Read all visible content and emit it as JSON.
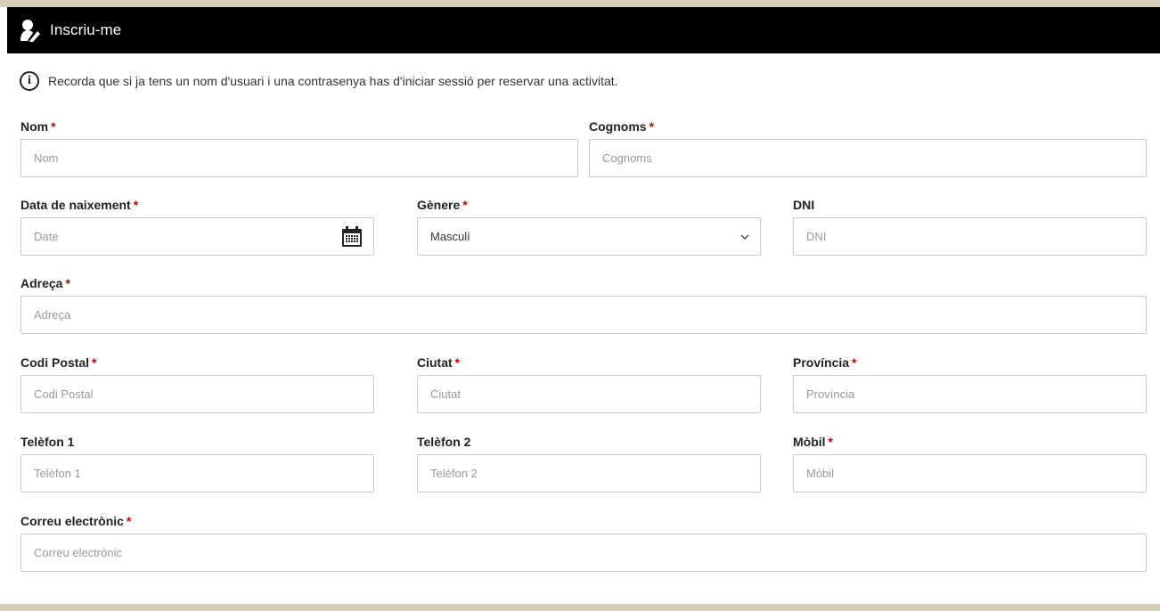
{
  "header": {
    "title": "Inscriu-me",
    "icon": "user-edit-icon"
  },
  "notice": {
    "icon": "info-icon",
    "text": "Recorda que si ja tens un nom d'usuari i una contrasenya has d'iniciar sessió per reservar una activitat."
  },
  "form": {
    "required_mark": "*",
    "nom": {
      "label": "Nom",
      "placeholder": "Nom"
    },
    "cognoms": {
      "label": "Cognoms",
      "placeholder": "Cognoms"
    },
    "data_naixement": {
      "label": "Data de naixement",
      "placeholder": "Date",
      "icon": "calendar-icon"
    },
    "genere": {
      "label": "Gènere",
      "value": "Masculí",
      "icon": "chevron-down-icon"
    },
    "dni": {
      "label": "DNI",
      "placeholder": "DNI"
    },
    "adreca": {
      "label": "Adreça",
      "placeholder": "Adreça"
    },
    "codi_postal": {
      "label": "Codi Postal",
      "placeholder": "Codi Postal"
    },
    "ciutat": {
      "label": "Ciutat",
      "placeholder": "Ciutat"
    },
    "provincia": {
      "label": "Província",
      "placeholder": "Província"
    },
    "telefon1": {
      "label": "Telèfon 1",
      "placeholder": "Telèfon 1"
    },
    "telefon2": {
      "label": "Telèfon 2",
      "placeholder": "Telèfon 2"
    },
    "mobil": {
      "label": "Mòbil",
      "placeholder": "Mòbil"
    },
    "correu": {
      "label": "Correu electrònic",
      "placeholder": "Correu electrònic"
    }
  },
  "colors": {
    "header_bg": "#000000",
    "required": "#cc0000",
    "strip": "#d8cdb8",
    "border": "#c9c9c9"
  }
}
